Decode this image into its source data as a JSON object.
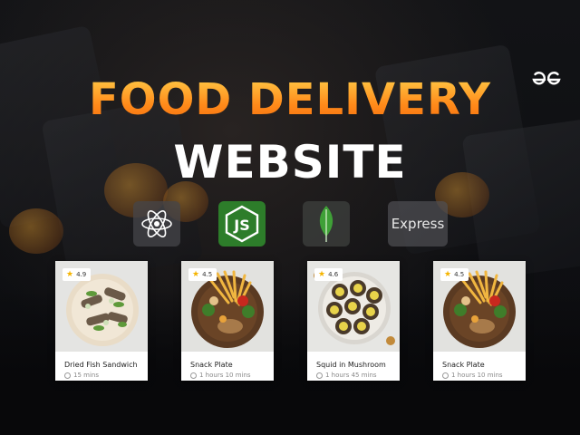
{
  "brand": {
    "logo_text": "ƏG",
    "logo_icon": "geeksforgeeks-logo-icon"
  },
  "headline": {
    "title": "FOOD DELIVERY",
    "subtitle": "WEBSITE"
  },
  "colors": {
    "title_gradient_top": "#ffcf4a",
    "title_gradient_bottom": "#f56e0e",
    "node_green": "#2d7d2a",
    "star": "#f5b400"
  },
  "tech_stack": [
    {
      "name": "react-logo-icon"
    },
    {
      "name": "nodejs-logo-icon"
    },
    {
      "name": "mongodb-leaf-icon"
    },
    {
      "name": "express-logo",
      "label": "Express"
    }
  ],
  "cards": [
    {
      "rating": "4.9",
      "name": "Dried Fish Sandwich",
      "time": "15 mins",
      "dish": "sandwich-plate"
    },
    {
      "rating": "4.5",
      "name": "Snack Plate",
      "time": "1 hours 10 mins",
      "dish": "snack-plate"
    },
    {
      "rating": "4.6",
      "name": "Squid in Mushroom",
      "time": "1 hours 45 mins",
      "dish": "mushroom-plate"
    },
    {
      "rating": "4.5",
      "name": "Snack Plate",
      "time": "1 hours 10 mins",
      "dish": "snack-plate"
    }
  ]
}
